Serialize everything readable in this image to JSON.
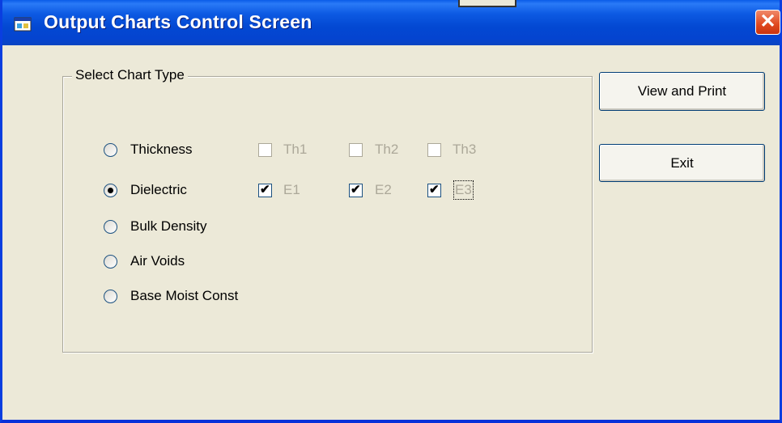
{
  "window": {
    "title": "Output Charts Control Screen",
    "close_glyph": "✕"
  },
  "group": {
    "legend": "Select Chart Type"
  },
  "radios": [
    {
      "label": "Thickness",
      "checked": false
    },
    {
      "label": "Dielectric",
      "checked": true
    },
    {
      "label": "Bulk Density",
      "checked": false
    },
    {
      "label": "Air Voids",
      "checked": false
    },
    {
      "label": "Base Moist Const",
      "checked": false
    }
  ],
  "thickness_checks": [
    {
      "label": "Th1",
      "checked": false,
      "enabled": false
    },
    {
      "label": "Th2",
      "checked": false,
      "enabled": false
    },
    {
      "label": "Th3",
      "checked": false,
      "enabled": false
    }
  ],
  "dielectric_checks": [
    {
      "label": "E1",
      "checked": true,
      "enabled": true
    },
    {
      "label": "E2",
      "checked": true,
      "enabled": true
    },
    {
      "label": "E3",
      "checked": true,
      "enabled": true
    }
  ],
  "buttons": {
    "view_print": "View and Print",
    "exit": "Exit"
  },
  "icons": {
    "title": "app-window-icon",
    "close": "close-icon"
  },
  "colors": {
    "titlebar": "#0348d2",
    "face": "#ece9d8",
    "close": "#e0481f",
    "disabled_text": "#aca899"
  }
}
